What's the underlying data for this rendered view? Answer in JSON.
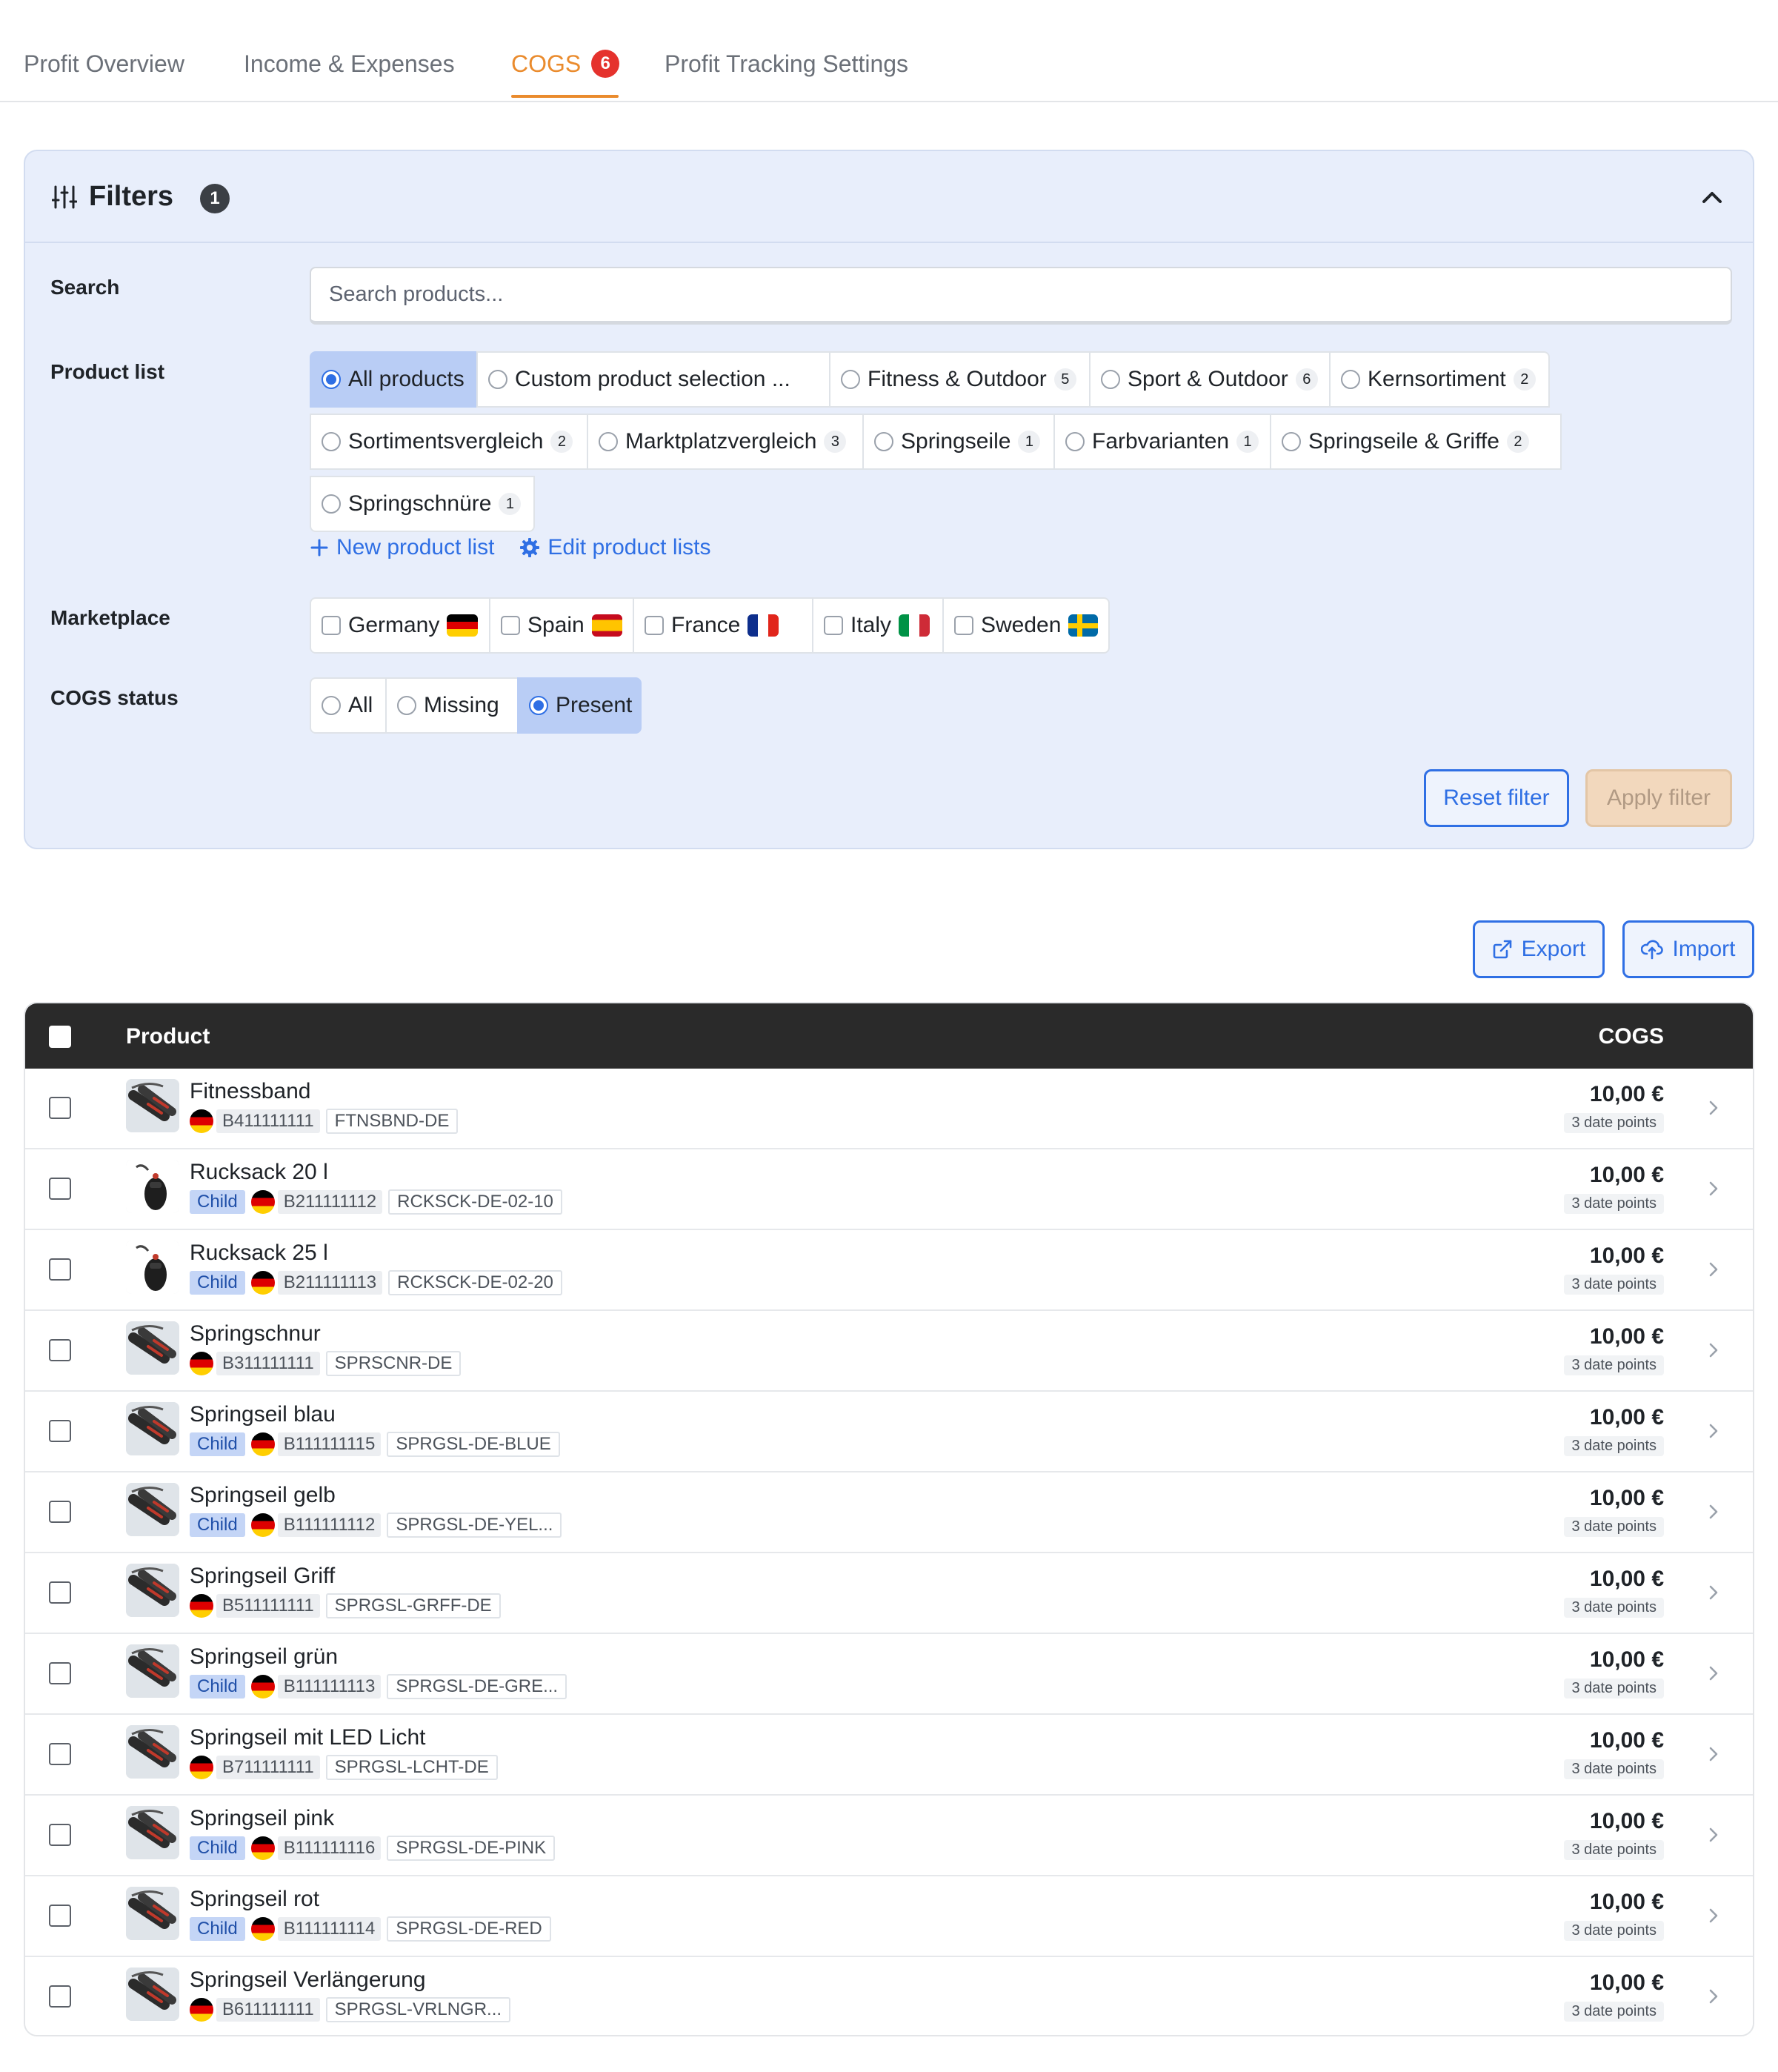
{
  "tabs": [
    {
      "label": "Profit Overview"
    },
    {
      "label": "Income & Expenses"
    },
    {
      "label": "COGS",
      "badge": "6"
    },
    {
      "label": "Profit Tracking Settings"
    }
  ],
  "colors": {
    "accent": "#ea8b2d",
    "primary": "#2f6fe4",
    "badge": "#e5322d"
  },
  "filters": {
    "title": "Filters",
    "badge": "1",
    "search_label": "Search",
    "search_placeholder": "Search products...",
    "product_list_label": "Product list",
    "product_lists": [
      {
        "label": "All products",
        "selected": true
      },
      {
        "label": "Custom product selection ..."
      },
      {
        "label": "Fitness & Outdoor",
        "count": "5"
      },
      {
        "label": "Sport & Outdoor",
        "count": "6"
      },
      {
        "label": "Kernsortiment",
        "count": "2"
      },
      {
        "label": "Sortimentsvergleich",
        "count": "2"
      },
      {
        "label": "Marktplatzvergleich",
        "count": "3"
      },
      {
        "label": "Springseile",
        "count": "1"
      },
      {
        "label": "Farbvarianten",
        "count": "1"
      },
      {
        "label": "Springseile & Griffe",
        "count": "2"
      },
      {
        "label": "Springschnüre",
        "count": "1"
      }
    ],
    "new_list_label": "New product list",
    "edit_lists_label": "Edit product lists",
    "marketplace_label": "Marketplace",
    "marketplaces": [
      {
        "label": "Germany",
        "flag": "de"
      },
      {
        "label": "Spain",
        "flag": "es"
      },
      {
        "label": "France",
        "flag": "fr"
      },
      {
        "label": "Italy",
        "flag": "it"
      },
      {
        "label": "Sweden",
        "flag": "se"
      }
    ],
    "cogs_status_label": "COGS status",
    "cogs_status": [
      {
        "label": "All"
      },
      {
        "label": "Missing"
      },
      {
        "label": "Present",
        "selected": true
      }
    ],
    "reset_label": "Reset filter",
    "apply_label": "Apply filter"
  },
  "actions": {
    "export_label": "Export",
    "import_label": "Import"
  },
  "table": {
    "col_product": "Product",
    "col_cogs": "COGS",
    "child_label": "Child",
    "rows": [
      {
        "name": "Fitnessband",
        "child": false,
        "asin": "B411111111",
        "sku": "FTNSBND-DE",
        "price": "10,00 €",
        "points": "3 date points",
        "thumb": "rope"
      },
      {
        "name": "Rucksack 20 l",
        "child": true,
        "asin": "B211111112",
        "sku": "RCKSCK-DE-02-10",
        "price": "10,00 €",
        "points": "3 date points",
        "thumb": "bag"
      },
      {
        "name": "Rucksack 25 l",
        "child": true,
        "asin": "B211111113",
        "sku": "RCKSCK-DE-02-20",
        "price": "10,00 €",
        "points": "3 date points",
        "thumb": "bag"
      },
      {
        "name": "Springschnur",
        "child": false,
        "asin": "B311111111",
        "sku": "SPRSCNR-DE",
        "price": "10,00 €",
        "points": "3 date points",
        "thumb": "rope"
      },
      {
        "name": "Springseil blau",
        "child": true,
        "asin": "B111111115",
        "sku": "SPRGSL-DE-BLUE",
        "price": "10,00 €",
        "points": "3 date points",
        "thumb": "rope"
      },
      {
        "name": "Springseil gelb",
        "child": true,
        "asin": "B111111112",
        "sku": "SPRGSL-DE-YEL...",
        "price": "10,00 €",
        "points": "3 date points",
        "thumb": "rope"
      },
      {
        "name": "Springseil Griff",
        "child": false,
        "asin": "B511111111",
        "sku": "SPRGSL-GRFF-DE",
        "price": "10,00 €",
        "points": "3 date points",
        "thumb": "rope"
      },
      {
        "name": "Springseil grün",
        "child": true,
        "asin": "B111111113",
        "sku": "SPRGSL-DE-GRE...",
        "price": "10,00 €",
        "points": "3 date points",
        "thumb": "rope"
      },
      {
        "name": "Springseil mit LED Licht",
        "child": false,
        "asin": "B711111111",
        "sku": "SPRGSL-LCHT-DE",
        "price": "10,00 €",
        "points": "3 date points",
        "thumb": "rope"
      },
      {
        "name": "Springseil pink",
        "child": true,
        "asin": "B111111116",
        "sku": "SPRGSL-DE-PINK",
        "price": "10,00 €",
        "points": "3 date points",
        "thumb": "rope"
      },
      {
        "name": "Springseil rot",
        "child": true,
        "asin": "B111111114",
        "sku": "SPRGSL-DE-RED",
        "price": "10,00 €",
        "points": "3 date points",
        "thumb": "rope"
      },
      {
        "name": "Springseil Verlängerung",
        "child": false,
        "asin": "B611111111",
        "sku": "SPRGSL-VRLNGR...",
        "price": "10,00 €",
        "points": "3 date points",
        "thumb": "rope"
      }
    ]
  }
}
